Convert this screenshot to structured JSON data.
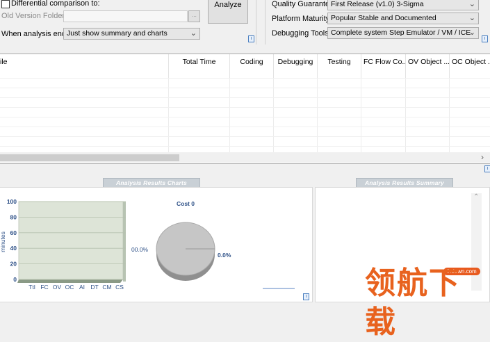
{
  "options": {
    "diff_checkbox_label": "Differential comparison to:",
    "old_version_label": "Old Version Folder:",
    "browse_label": "...",
    "analysis_ends_label": "When analysis ends:",
    "analysis_ends_value": "Just show summary and charts",
    "analyze_button": "Analyze"
  },
  "settings": {
    "quality_label": "Quality Guarantee:",
    "quality_value": "First Release (v1.0) 3-Sigma",
    "platform_label": "Platform Maturity:",
    "platform_value": "Popular Stable and Documented",
    "debugging_label": "Debugging Tools:",
    "debugging_value": "Complete system Step Emulator / VM / ICE"
  },
  "grid": {
    "columns": [
      "ile",
      "Total Time",
      "Coding",
      "Debugging",
      "Testing",
      "FC Flow Co...",
      "OV Object ...",
      "OC Object ..."
    ]
  },
  "charts_panel": {
    "title": "Analysis Results Charts",
    "bar_ylabel": "minutes",
    "cost_title": "Cost 0",
    "pie_left_label": "00.0%",
    "pie_right_label": "0.0%"
  },
  "summary_panel": {
    "title": "Analysis Results Summary"
  },
  "watermark": {
    "url": "lhdown.com",
    "text": "领航下载"
  },
  "chart_data": [
    {
      "type": "bar",
      "title": "",
      "ylabel": "minutes",
      "categories": [
        "Ttl",
        "FC",
        "OV",
        "OC",
        "AI",
        "DT",
        "CM",
        "CS"
      ],
      "values": [
        0,
        0,
        0,
        0,
        0,
        0,
        0,
        0
      ],
      "yticks": [
        "100",
        "80",
        "60",
        "40",
        "20",
        "0"
      ],
      "ylim": [
        0,
        100
      ],
      "grid": true
    },
    {
      "type": "pie",
      "title": "Cost 0",
      "slices": [
        {
          "label": "00.0%",
          "value": 100
        },
        {
          "label": "0.0%",
          "value": 0
        }
      ]
    }
  ]
}
